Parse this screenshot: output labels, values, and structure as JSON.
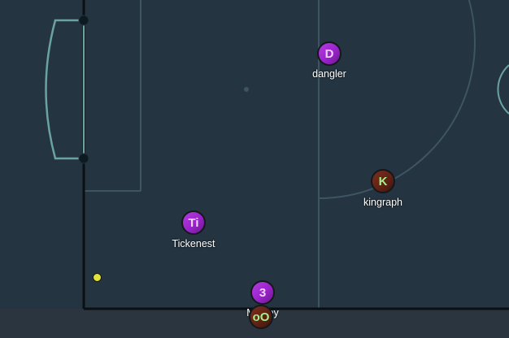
{
  "pitch": {
    "colors": {
      "surface": "#243440",
      "outer": "#2a3540",
      "line": "#3d5563",
      "boundary": "#0b0f12",
      "goal_frame": "#6aa3a0",
      "post": "#0e1a22"
    }
  },
  "ball": {
    "color": "#e3e23a"
  },
  "players": [
    {
      "id": "dangler",
      "initials": "D",
      "name": "dangler",
      "team": "home"
    },
    {
      "id": "kingraph",
      "initials": "K",
      "name": "kingraph",
      "team": "away"
    },
    {
      "id": "tickenest",
      "initials": "Ti",
      "name": "Tickenest",
      "team": "home"
    },
    {
      "id": "mosley",
      "initials": "3",
      "name": "Mosley",
      "team": "home"
    },
    {
      "id": "away-oo",
      "initials": "oO",
      "name": "",
      "team": "away"
    }
  ]
}
